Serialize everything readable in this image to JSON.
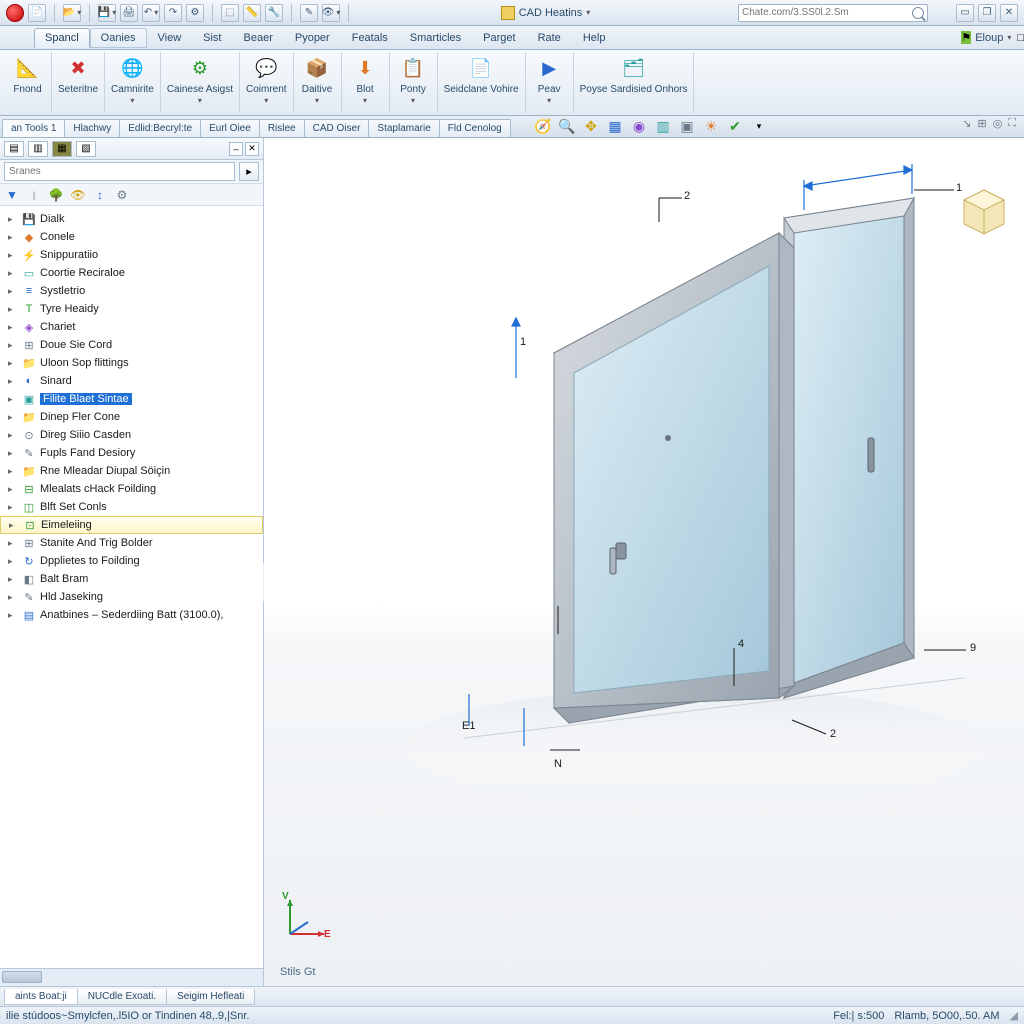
{
  "qat": {
    "title": "CAD Heatins",
    "search_placeholder": "Chate.com/3.SS0l.2.Sm",
    "right_label": "Eloup"
  },
  "menubar": {
    "items": [
      "Spancl",
      "Oanies",
      "View",
      "Sist",
      "Beaer",
      "Pyoper",
      "Featals",
      "Smarticles",
      "Parget",
      "Rate",
      "Help"
    ],
    "active_index": 0
  },
  "ribbon": {
    "groups": [
      {
        "label": "Fnond",
        "icon": "📐",
        "dd": false
      },
      {
        "label": "Seteritne",
        "icon": "✖",
        "dd": false
      },
      {
        "label": "Camnirite",
        "icon": "🌐",
        "dd": true
      },
      {
        "label": "Cainese Asigst",
        "icon": "⚙",
        "dd": true
      },
      {
        "label": "Coimrent",
        "icon": "💬",
        "dd": true
      },
      {
        "label": "Daitive",
        "icon": "📦",
        "dd": true
      },
      {
        "label": "Blot",
        "icon": "⬇",
        "dd": true
      },
      {
        "label": "Ponty",
        "icon": "📋",
        "dd": true
      },
      {
        "label": "Seidclane Vohire",
        "icon": "📄",
        "dd": false
      },
      {
        "label": "Peav",
        "icon": "▶",
        "dd": true
      },
      {
        "label": "Poyse Sardisied Onhors",
        "icon": "🗂",
        "dd": false
      }
    ]
  },
  "tabstrip": {
    "tabs": [
      "an Tools 1",
      "Hlachwy",
      "Edlid:Becryl:te",
      "Eurl Oiee",
      "Rislee",
      "CAD Oiser",
      "Staplamarie",
      "Fld Cenolog"
    ],
    "active_index": 0
  },
  "sidebar": {
    "search_placeholder": "Sranes",
    "items": [
      {
        "icon": "💾",
        "label": "Dialk",
        "color": "c-blu"
      },
      {
        "icon": "◆",
        "label": "Conele",
        "color": "c-org"
      },
      {
        "icon": "⚡",
        "label": "Snippuratiio",
        "color": "c-grn"
      },
      {
        "icon": "▭",
        "label": "Coortie Reciraloe",
        "color": "c-teal"
      },
      {
        "icon": "≡",
        "label": "Systletrio",
        "color": "c-blu"
      },
      {
        "icon": "T",
        "label": "Tyre Heaidy",
        "color": "c-grn"
      },
      {
        "icon": "◈",
        "label": "Chariet",
        "color": "c-pur"
      },
      {
        "icon": "⊞",
        "label": "Doue Sie Cord",
        "color": "c-gry"
      },
      {
        "icon": "📁",
        "label": "Uloon Sop flittings",
        "color": "c-yel"
      },
      {
        "icon": "◐",
        "label": "Sinard",
        "color": "c-blu"
      },
      {
        "icon": "▣",
        "label": "Filite Blaet Sintae",
        "color": "c-teal",
        "selected": true
      },
      {
        "icon": "📁",
        "label": "Dinep Fler Cone",
        "color": "c-yel"
      },
      {
        "icon": "⊙",
        "label": "Direg Siiio Casden",
        "color": "c-gry"
      },
      {
        "icon": "✎",
        "label": "Fupls Fand Desiory",
        "color": "c-gry"
      },
      {
        "icon": "📁",
        "label": "Rne Mleadar Diupal Söiçin",
        "color": "c-yel"
      },
      {
        "icon": "⊟",
        "label": "Mlealats cHack Foilding",
        "color": "c-grn"
      },
      {
        "icon": "◫",
        "label": "Blft Set Conls",
        "color": "c-grn"
      },
      {
        "icon": "⊡",
        "label": "Eimeleiing",
        "color": "c-grn",
        "hover": true
      },
      {
        "icon": "⊞",
        "label": "Stanite And Trig Bolder",
        "color": "c-gry"
      },
      {
        "icon": "↻",
        "label": "Dpplietes to Foilding",
        "color": "c-blu"
      },
      {
        "icon": "◧",
        "label": "Balt Bram",
        "color": "c-gry"
      },
      {
        "icon": "✎",
        "label": "Hld Jaseking",
        "color": "c-gry"
      },
      {
        "icon": "▤",
        "label": "Anatbines – Sederdiing Batt (3100.0),",
        "color": "c-blu"
      }
    ]
  },
  "viewport": {
    "triad": {
      "x": "E",
      "y": "V",
      "z": ""
    },
    "label_bottom": "Stils Gt",
    "dims": {
      "d1": "1",
      "d2": "2",
      "d2b": "2",
      "d4": "4",
      "d9": "9",
      "dN": "N",
      "dE1": "E1",
      "d1b": "1"
    }
  },
  "btabs": {
    "tabs": [
      "aints Boat:ji",
      "NUCdle Exoati.",
      "Seigim Hefleati"
    ],
    "active_index": 0
  },
  "status": {
    "left": "ilie stúdoos~Smylcfen,.l5IO or Tindinen 48,.9,|Snr.",
    "mid": "Fel:| s:500",
    "right": "Rlamb, 5O00,.50. AM"
  }
}
